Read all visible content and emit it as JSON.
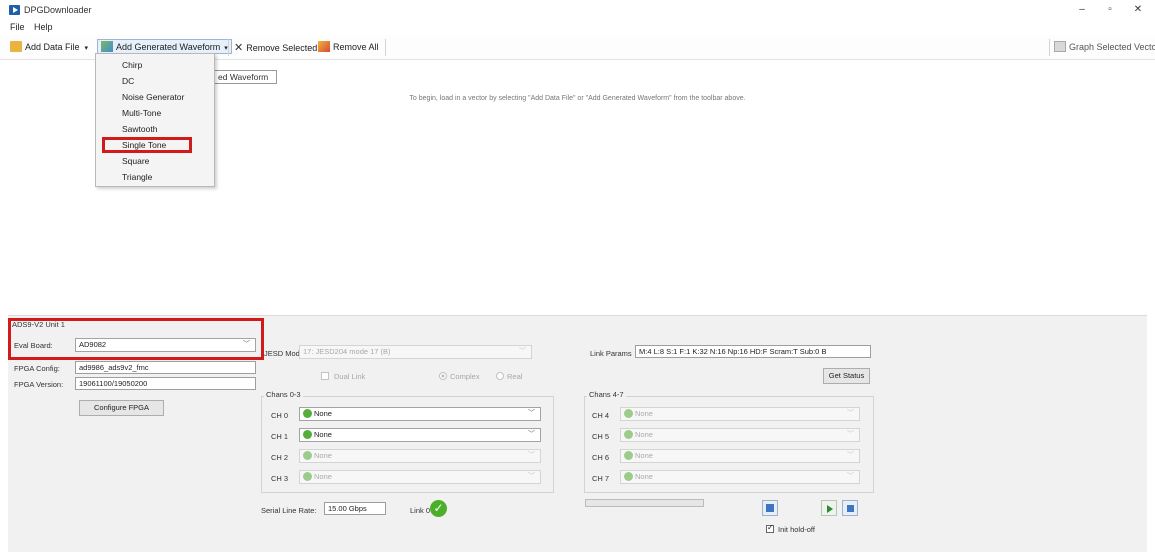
{
  "app": {
    "title": "DPGDownloader"
  },
  "window_controls": {
    "minimize": "–",
    "maximize": "▫",
    "close": "✕"
  },
  "menu": [
    "File",
    "Help"
  ],
  "toolbar": {
    "add_data_file": "Add Data File",
    "add_generated_waveform": "Add Generated Waveform",
    "remove_selected": "Remove Selected",
    "remove_all": "Remove All",
    "graph_selected_vector": "Graph Selected Vector"
  },
  "dropdown": {
    "items": [
      "Chirp",
      "DC",
      "Noise Generator",
      "Multi-Tone",
      "Sawtooth",
      "Single Tone",
      "Square",
      "Triangle"
    ],
    "highlighted": "Single Tone"
  },
  "tooltip": "ed Waveform",
  "main_hint": "To begin, load in a vector by selecting \"Add Data File\" or \"Add Generated Waveform\" from the toolbar above.",
  "board_panel": {
    "unit_title": "ADS9-V2 Unit 1",
    "eval_board_label": "Eval Board:",
    "eval_board_value": "AD9082",
    "fpga_config_label": "FPGA Config:",
    "fpga_config_value": "ad9986_ads9v2_fmc",
    "fpga_version_label": "FPGA Version:",
    "fpga_version_value": "19061100/19050200",
    "configure_button": "Configure FPGA"
  },
  "jesd": {
    "mode_label": "JESD Mode",
    "mode_value": "17: JESD204 mode 17 (B)",
    "dual_link": "Dual Link",
    "complex": "Complex",
    "real": "Real",
    "link_params_label": "Link Params",
    "link_params_value": "M:4 L:8 S:1 F:1 K:32 N:16 Np:16 HD:F Scram:T Sub:0 B",
    "get_status": "Get Status"
  },
  "chans_0_3": {
    "title": "Chans 0-3",
    "rows": [
      {
        "label": "CH 0",
        "value": "None",
        "enabled": true
      },
      {
        "label": "CH 1",
        "value": "None",
        "enabled": true
      },
      {
        "label": "CH 2",
        "value": "None",
        "enabled": false
      },
      {
        "label": "CH 3",
        "value": "None",
        "enabled": false
      }
    ]
  },
  "chans_4_7": {
    "title": "Chans 4-7",
    "rows": [
      {
        "label": "CH 4",
        "value": "None",
        "enabled": false
      },
      {
        "label": "CH 5",
        "value": "None",
        "enabled": false
      },
      {
        "label": "CH 6",
        "value": "None",
        "enabled": false
      },
      {
        "label": "CH 7",
        "value": "None",
        "enabled": false
      }
    ]
  },
  "serial": {
    "label": "Serial Line Rate:",
    "value": "15.00 Gbps",
    "link_label": "Link 0"
  },
  "playback": {
    "init_holdoff": "Init hold-off"
  },
  "colors": {
    "highlight_red": "#d11a1a",
    "status_green": "#4caf2a"
  }
}
